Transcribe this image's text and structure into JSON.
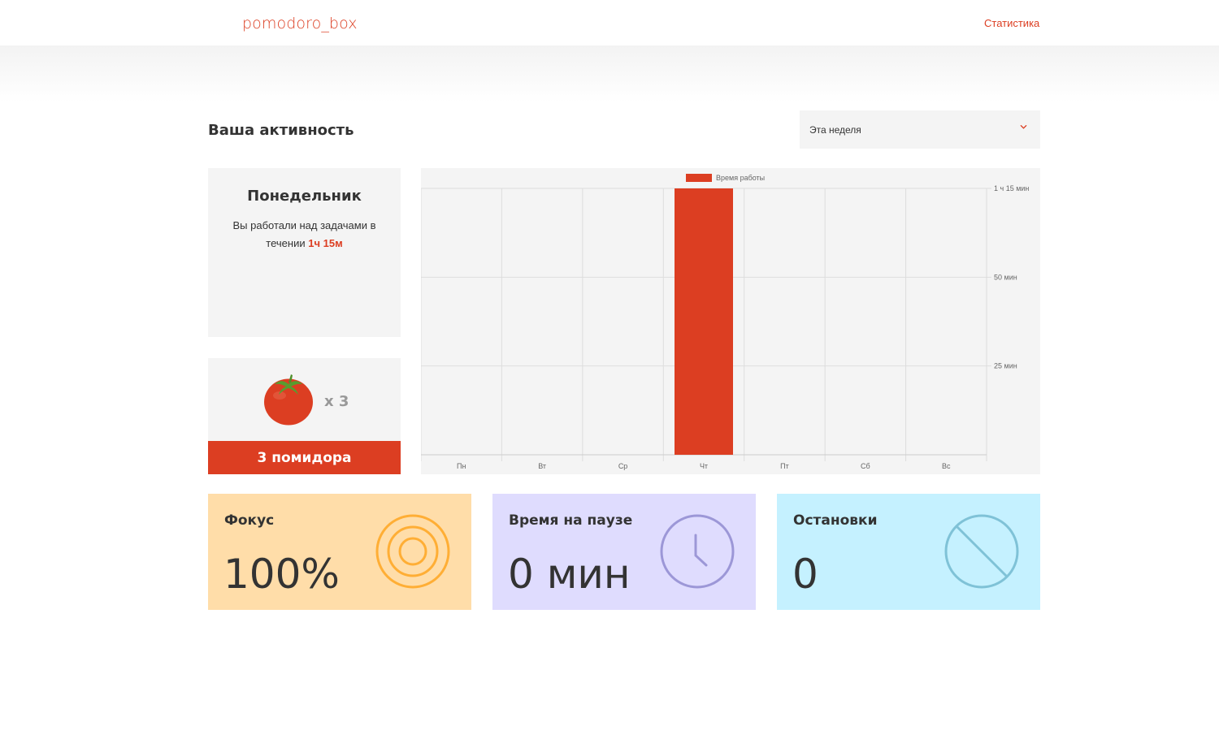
{
  "header": {
    "logo": "pomodoro_box",
    "nav_link": "Статистика"
  },
  "page": {
    "title": "Ваша активность",
    "period_select": "Эта неделя"
  },
  "day_card": {
    "title": "Понедельник",
    "text": "Вы работали над задачами в течении ",
    "highlight": "1ч 15м"
  },
  "tomato_card": {
    "count": "x 3",
    "banner": "3 помидора"
  },
  "stats": {
    "focus": {
      "title": "Фокус",
      "value": "100%"
    },
    "pause": {
      "title": "Время на паузе",
      "value": "0 мин"
    },
    "stops": {
      "title": "Остановки",
      "value": "0"
    }
  },
  "colors": {
    "accent": "#dc3e22",
    "focus_bg": "#ffdda9",
    "focus_icon": "#ffae35",
    "pause_bg": "#dfdcfe",
    "pause_icon": "#9c97d7",
    "stops_bg": "#c5f1ff",
    "stops_icon": "#7fc2d7"
  },
  "chart_data": {
    "type": "bar",
    "categories": [
      "Пн",
      "Вт",
      "Ср",
      "Чт",
      "Пт",
      "Сб",
      "Вс"
    ],
    "series": [
      {
        "name": "Время работы",
        "values": [
          0,
          0,
          0,
          75,
          0,
          0,
          0
        ]
      }
    ],
    "y_unit": "min",
    "ylim": [
      0,
      75
    ],
    "yticks": [
      25,
      50,
      75
    ],
    "ytick_labels": [
      "25 мин",
      "50 мин",
      "1 ч 15 мин"
    ],
    "y_axis_side": "right",
    "legend": "top-center",
    "grid": true
  }
}
